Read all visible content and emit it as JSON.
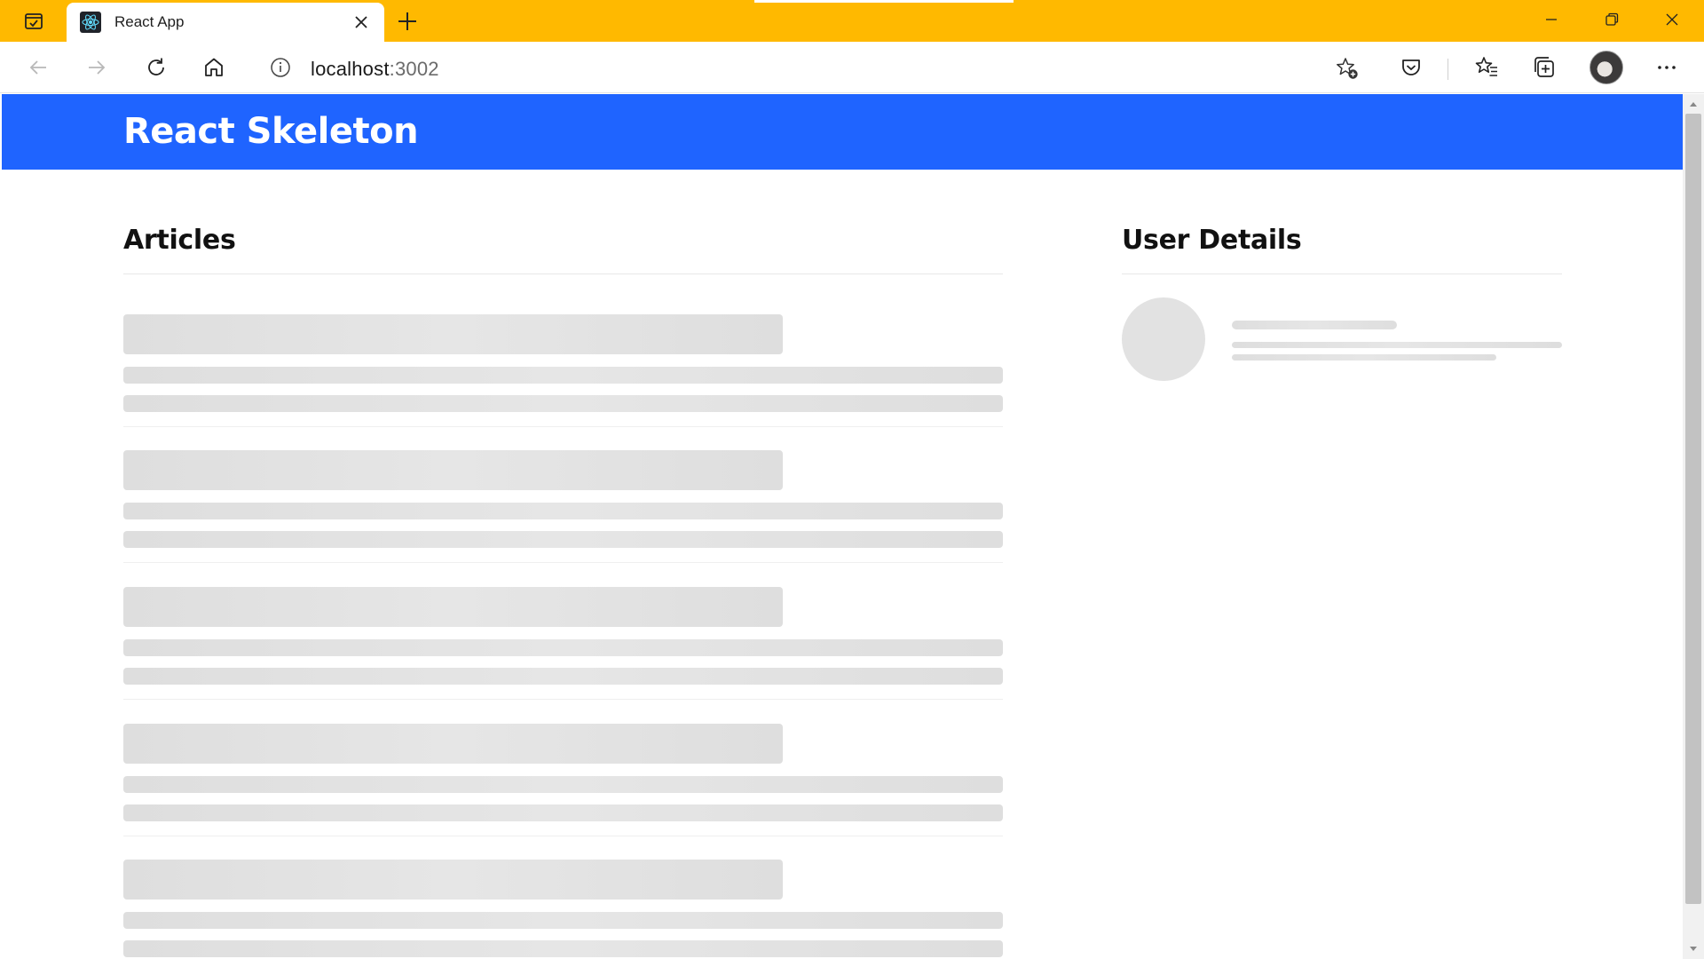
{
  "browser": {
    "tab_title": "React App",
    "url_host": "localhost",
    "url_port": ":3002",
    "icons": [
      "tab-actions-icon",
      "react-favicon",
      "close-icon",
      "plus-icon",
      "minimize-icon",
      "restore-icon",
      "window-close-icon",
      "back-arrow-icon",
      "forward-arrow-icon",
      "refresh-icon",
      "home-icon",
      "info-icon",
      "add-favorite-icon",
      "pocket-icon",
      "favorites-icon",
      "collections-icon",
      "more-icon"
    ],
    "accent": "#ffb900"
  },
  "page": {
    "app_title": "React Skeleton",
    "articles_heading": "Articles",
    "user_heading": "User Details",
    "header_color": "#1f64ff",
    "skeleton_color": "#e2e2e2"
  }
}
